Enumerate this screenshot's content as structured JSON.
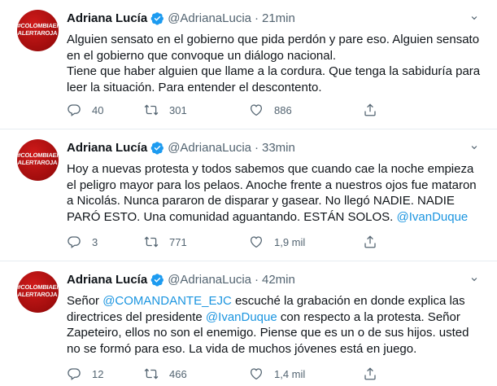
{
  "tweets": [
    {
      "name": "Adriana Lucía",
      "handle": "@AdrianaLucia",
      "dot": "·",
      "time": "21min",
      "avatar_text": "#COLOMBIAEN ALERTAROJA",
      "lines": [
        "Alguien sensato en el gobierno que pida perdón y pare eso. Alguien sensato en el gobierno que convoque un diálogo nacional.",
        "Tiene que haber alguien que llame a la cordura. Que tenga la sabiduría para leer la situación. Para entender el descontento."
      ],
      "replies": "40",
      "retweets": "301",
      "likes": "886"
    },
    {
      "name": "Adriana Lucía",
      "handle": "@AdrianaLucia",
      "dot": "·",
      "time": "33min",
      "avatar_text": "#COLOMBIAEN ALERTAROJA",
      "text_before": "Hoy a nuevas protesta y todos sabemos que cuando cae la noche empieza el peligro mayor para los pelaos. Anoche frente a nuestros ojos fue mataron a Nicolás. Nunca pararon de disparar y gasear. No llegó NADIE. NADIE PARÓ ESTO. Una comunidad aguantando. ESTÁN SOLOS. ",
      "mention1": "@IvanDuque",
      "replies": "3",
      "retweets": "771",
      "likes": "1,9 mil"
    },
    {
      "name": "Adriana Lucía",
      "handle": "@AdrianaLucia",
      "dot": "·",
      "time": "42min",
      "avatar_text": "#COLOMBIAEN ALERTAROJA",
      "text_a": "Señor ",
      "mention_a": "@COMANDANTE_EJC",
      "text_b": " escuché la grabación en donde explica las directrices del presidente ",
      "mention_b": "@IvanDuque",
      "text_c": " con respecto a la protesta. Señor Zapeteiro, ellos no son el enemigo. Piense que es un o de sus hijos. usted no se formó para eso. La vida de muchos jóvenes está en juego.",
      "replies": "12",
      "retweets": "466",
      "likes": "1,4 mil"
    }
  ],
  "colors": {
    "text": "#0f1419",
    "secondary": "#536471",
    "link": "#1b95e0",
    "verified": "#1d9bf0",
    "avatar": "#b31212"
  },
  "icons": [
    "verified-badge-icon",
    "more-icon",
    "reply-icon",
    "retweet-icon",
    "like-icon",
    "share-icon"
  ]
}
